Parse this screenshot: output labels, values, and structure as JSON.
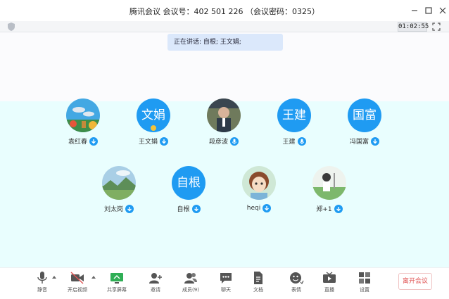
{
  "window": {
    "title": "腾讯会议  会议号：402 501 226 （会议密码：0325）"
  },
  "infobar": {
    "timer": "01:02:55"
  },
  "speaking": {
    "text": "正在讲话: 自根; 王文娟;"
  },
  "participants": [
    {
      "name": "袁红春",
      "avatar_text": "",
      "avatar_kind": "photo-dolphin"
    },
    {
      "name": "王文娟",
      "avatar_text": "文娟",
      "avatar_kind": "text"
    },
    {
      "name": "段彦波",
      "avatar_text": "",
      "avatar_kind": "photo-person"
    },
    {
      "name": "王建",
      "avatar_text": "王建",
      "avatar_kind": "text"
    },
    {
      "name": "冯国富",
      "avatar_text": "国富",
      "avatar_kind": "text"
    },
    {
      "name": "刘太岗",
      "avatar_text": "",
      "avatar_kind": "photo-landscape"
    },
    {
      "name": "自根",
      "avatar_text": "自根",
      "avatar_kind": "text"
    },
    {
      "name": "heqi",
      "avatar_text": "",
      "avatar_kind": "photo-anime-girl"
    },
    {
      "name": "郑+1",
      "avatar_text": "",
      "avatar_kind": "photo-anime-scene"
    }
  ],
  "toolbar": {
    "mute": "静音",
    "video": "开启视频",
    "share": "共享屏幕",
    "invite": "邀请",
    "members": "成员(9)",
    "chat": "聊天",
    "docs": "文档",
    "reactions": "表情",
    "live": "直播",
    "settings": "设置",
    "end": "离开会议"
  },
  "colors": {
    "accent": "#1f9bf2",
    "participant_bg": "#e9fefe",
    "speaking_bg": "#dbe8fb",
    "end_red": "#e05555"
  }
}
